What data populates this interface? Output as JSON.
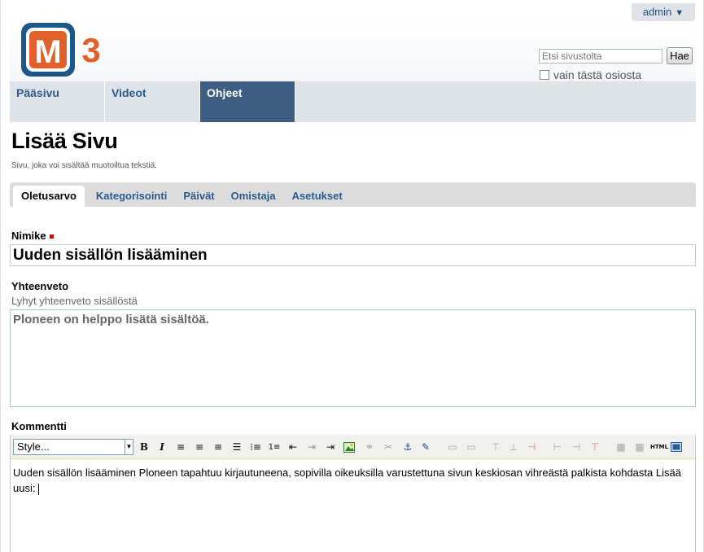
{
  "header": {
    "admin_label": "admin",
    "logo": {
      "letter": "M",
      "digit": "3",
      "box_color": "#e0612a",
      "frame_color": "#1d5689",
      "digit_color": "#e0612a"
    },
    "search": {
      "placeholder": "Etsi sivustolta",
      "button": "Hae",
      "scope_label": "vain tästä osiosta"
    }
  },
  "nav": {
    "items": [
      {
        "label": "Pääsivu"
      },
      {
        "label": "Videot"
      },
      {
        "label": "Ohjeet",
        "active": true
      }
    ]
  },
  "page": {
    "title": "Lisää Sivu",
    "description": "Sivu, joka voi sisältää muotoiltua tekstiä."
  },
  "tabs": [
    {
      "label": "Oletusarvo",
      "active": true
    },
    {
      "label": "Kategorisointi"
    },
    {
      "label": "Päivät"
    },
    {
      "label": "Omistaja"
    },
    {
      "label": "Asetukset"
    }
  ],
  "fields": {
    "title_label": "Nimike",
    "title_value": "Uuden sisällön lisääminen",
    "summary_label": "Yhteenveto",
    "summary_help": "Lyhyt yhteenveto sisällöstä",
    "summary_value": "Ploneen on helppo lisätä sisältöä.",
    "comment_label": "Kommentti"
  },
  "editor": {
    "style_select": "Style...",
    "icons": [
      "bold-icon",
      "italic-icon",
      "align-left-icon",
      "align-center-icon",
      "align-right-icon",
      "align-justify-icon",
      "bullet-list-icon",
      "numbered-list-icon",
      "outdent-icon",
      "indent-icon",
      "image-icon",
      "link-icon",
      "unlink-icon",
      "anchor-icon",
      "edit-icon",
      "table-icon",
      "table-props-icon",
      "insert-row-before-icon",
      "insert-row-after-icon",
      "delete-row-icon",
      "insert-col-before-icon",
      "insert-col-after-icon",
      "delete-col-icon",
      "merge-cells-icon",
      "split-cells-icon",
      "html-source-icon",
      "fullscreen-icon"
    ],
    "html_label": "HTML",
    "content": "Uuden sisällön lisääminen Ploneen tapahtuu kirjautuneena, sopivilla oikeuksilla varustettuna sivun keskiosan vihreästä palkista kohdasta Lisää uusi:"
  }
}
